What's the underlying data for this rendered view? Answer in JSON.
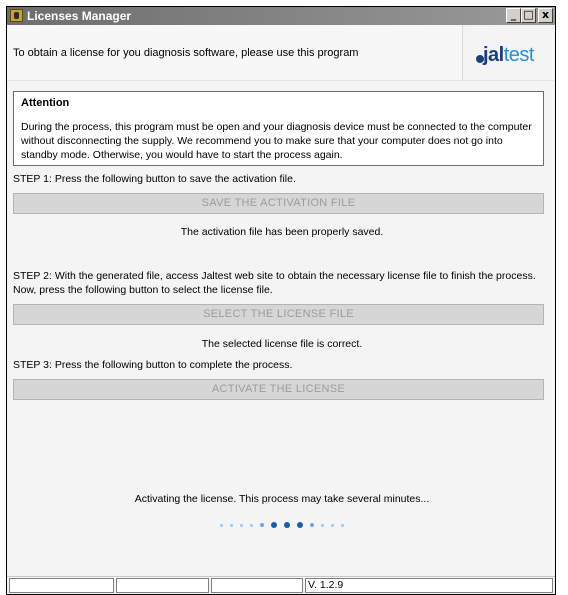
{
  "window": {
    "title": "Licenses Manager",
    "controls": {
      "minimize": "_",
      "maximize": "□",
      "close": "x"
    }
  },
  "header": {
    "intro": "To obtain a license for you diagnosis software, please use this program",
    "logo": {
      "text_bold": "jal",
      "text_light": "test"
    }
  },
  "attention": {
    "title": "Attention",
    "body": "During the process, this program must be open and your diagnosis device must be connected to the computer without disconnecting the supply. We recommend you to make sure that your computer does not go into standby mode. Otherwise, you would have to start the process again."
  },
  "steps": [
    {
      "text": "STEP 1: Press the following button to save the activation file.",
      "button": "SAVE THE ACTIVATION FILE",
      "status": "The activation file has been properly saved."
    },
    {
      "text": "STEP 2: With the generated file, access Jaltest web site to obtain the necessary license file to finish the process. Now, press the following button to select the license file.",
      "button": "SELECT THE LICENSE FILE",
      "status": "The selected license file is correct."
    },
    {
      "text": "STEP 3: Press the following button to complete the process.",
      "button": "ACTIVATE THE LICENSE",
      "status": "Activating the license. This process may take several minutes..."
    }
  ],
  "statusbar": {
    "panels": [
      "",
      "",
      "",
      "V. 1.2.9"
    ]
  },
  "colors": {
    "logo_dark": "#1a3f7a",
    "logo_light": "#2a8fd0",
    "attention_border": "#5a69b0",
    "button_disabled_bg": "#d6d6d6"
  }
}
